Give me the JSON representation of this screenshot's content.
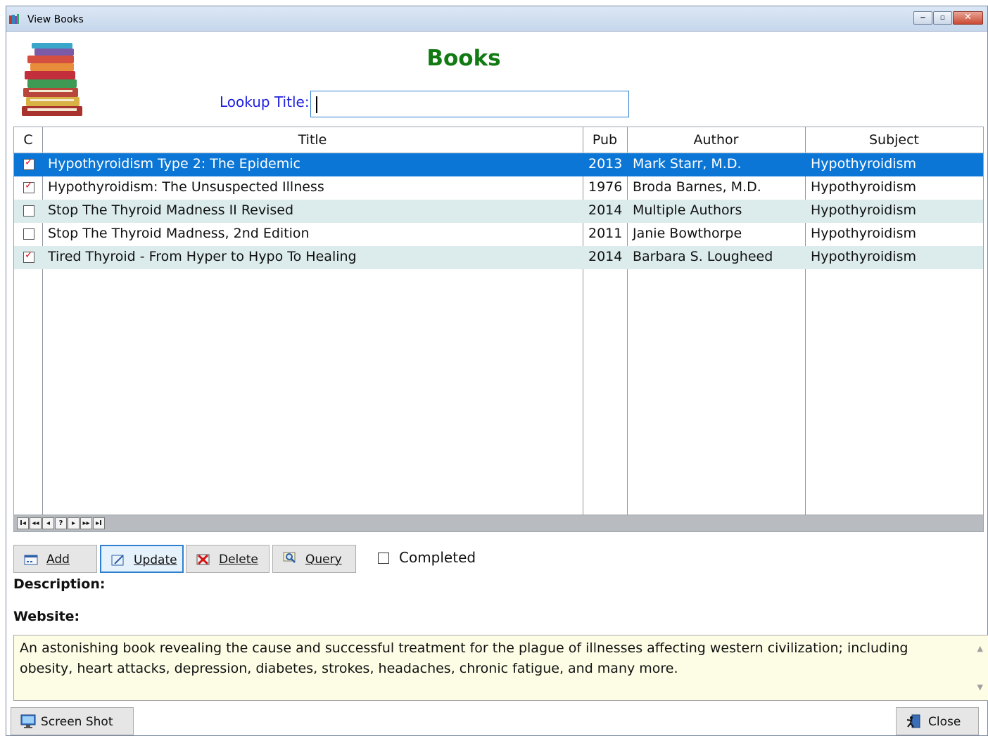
{
  "window": {
    "title": "View Books",
    "buttons": [
      "minimize",
      "maximize",
      "close"
    ]
  },
  "header": {
    "heading": "Books",
    "lookup_label": "Lookup Title:",
    "lookup_value": ""
  },
  "grid": {
    "columns": [
      "C",
      "Title",
      "Pub",
      "Author",
      "Subject"
    ],
    "rows": [
      {
        "checked": true,
        "title": "Hypothyroidism Type 2: The Epidemic",
        "pub": "2013",
        "author": "Mark Starr, M.D.",
        "subject": "Hypothyroidism",
        "selected": true
      },
      {
        "checked": true,
        "title": "Hypothyroidism: The Unsuspected Illness",
        "pub": "1976",
        "author": "Broda Barnes, M.D.",
        "subject": "Hypothyroidism",
        "selected": false
      },
      {
        "checked": false,
        "title": "Stop The Thyroid Madness II Revised",
        "pub": "2014",
        "author": "Multiple Authors",
        "subject": "Hypothyroidism",
        "selected": false
      },
      {
        "checked": false,
        "title": "Stop The Thyroid Madness, 2nd Edition",
        "pub": "2011",
        "author": "Janie Bowthorpe",
        "subject": "Hypothyroidism",
        "selected": false
      },
      {
        "checked": true,
        "title": "Tired Thyroid - From Hyper to Hypo To Healing",
        "pub": "2014",
        "author": "Barbara S. Lougheed",
        "subject": "Hypothyroidism",
        "selected": false
      }
    ],
    "navigator": [
      "I◂",
      "◂◂",
      "◂",
      "?",
      "▸",
      "▸▸",
      "▸I"
    ]
  },
  "actions": {
    "add": "Add",
    "update": "Update",
    "delete": "Delete",
    "query": "Query",
    "completed_label": "Completed",
    "completed_checked": false
  },
  "details": {
    "description_label": "Description:",
    "website_label": "Website:",
    "description_text": "An astonishing book revealing the cause and successful treatment for the plague of illnesses affecting western civilization; including obesity, heart attacks, depression, diabetes, strokes, headaches, chronic fatigue, and many more."
  },
  "footer": {
    "screenshot": "Screen Shot",
    "close": "Close"
  },
  "colors": {
    "heading": "#127a12",
    "lookup_label": "#2020e0",
    "selected_row": "#0b76d6",
    "alt_row": "#dcecec",
    "description_bg": "#fdfde6"
  },
  "icons": {
    "app": "books-icon",
    "logo": "stacked-books-icon",
    "add": "add-form-icon",
    "update": "edit-form-icon",
    "delete": "delete-x-icon",
    "query": "magnifier-icon",
    "screenshot": "monitor-icon",
    "close": "exit-door-icon"
  }
}
